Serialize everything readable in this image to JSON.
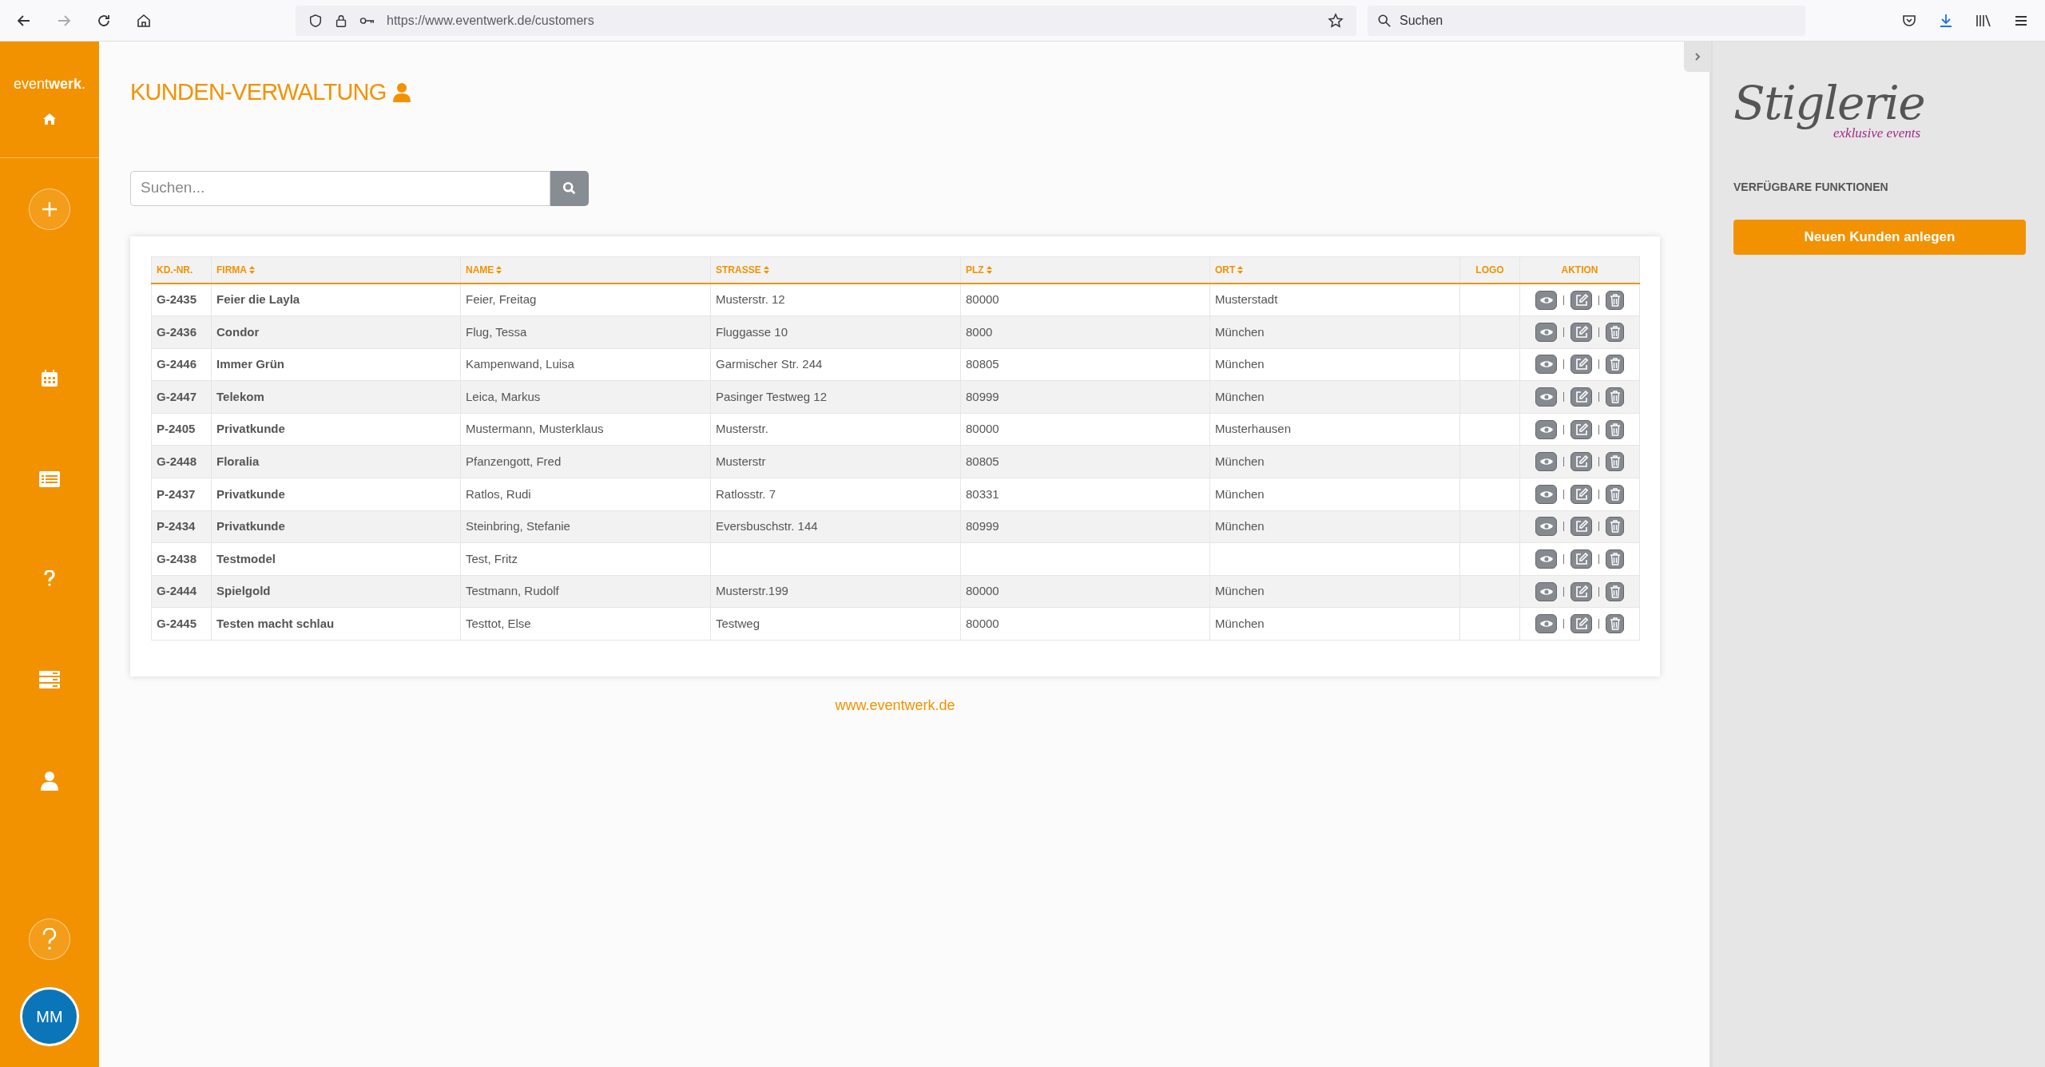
{
  "browser": {
    "url": "https://www.eventwerk.de/customers",
    "search_placeholder": "Suchen"
  },
  "sidebar": {
    "logo": "event**werk**.",
    "avatar": "MM"
  },
  "page": {
    "title": "KUNDEN-VERWALTUNG",
    "search_placeholder": "Suchen..."
  },
  "table": {
    "columns": [
      {
        "label": "KD.-NR.",
        "sortable": false
      },
      {
        "label": "FIRMA",
        "sortable": true
      },
      {
        "label": "NAME",
        "sortable": true
      },
      {
        "label": "STRASSE",
        "sortable": true
      },
      {
        "label": "PLZ",
        "sortable": true
      },
      {
        "label": "ORT",
        "sortable": true
      },
      {
        "label": "LOGO",
        "sortable": false
      },
      {
        "label": "AKTION",
        "sortable": false
      }
    ],
    "rows": [
      [
        "G-2435",
        "Feier die Layla",
        "Feier, Freitag",
        "Musterstr. 12",
        "80000",
        "Musterstadt"
      ],
      [
        "G-2436",
        "Condor",
        "Flug, Tessa",
        "Fluggasse 10",
        "8000",
        "München"
      ],
      [
        "G-2446",
        "Immer Grün",
        "Kampenwand, Luisa",
        "Garmischer Str. 244",
        "80805",
        "München"
      ],
      [
        "G-2447",
        "Telekom",
        "Leica, Markus",
        "Pasinger Testweg 12",
        "80999",
        "München"
      ],
      [
        "P-2405",
        "Privatkunde",
        "Mustermann, Musterklaus",
        "Musterstr.",
        "80000",
        "Musterhausen"
      ],
      [
        "G-2448",
        "Floralia",
        "Pfanzengott, Fred",
        "Musterstr",
        "80805",
        "München"
      ],
      [
        "P-2437",
        "Privatkunde",
        "Ratlos, Rudi",
        "Ratlosstr. 7",
        "80331",
        "München"
      ],
      [
        "P-2434",
        "Privatkunde",
        "Steinbring, Stefanie",
        "Eversbuschstr. 144",
        "80999",
        "München"
      ],
      [
        "G-2438",
        "Testmodel",
        "Test, Fritz",
        "",
        "",
        ""
      ],
      [
        "G-2444",
        "Spielgold",
        "Testmann, Rudolf",
        "Musterstr.199",
        "80000",
        "München"
      ],
      [
        "G-2445",
        "Testen macht schlau",
        "Testtot, Else",
        "Testweg",
        "80000",
        "München"
      ]
    ]
  },
  "footer_link": "www.eventwerk.de",
  "right_panel": {
    "logo": "Stiglerie",
    "logo_tagline": "exklusive events",
    "heading": "VERFÜGBARE FUNKTIONEN",
    "button": "Neuen Kunden anlegen"
  }
}
